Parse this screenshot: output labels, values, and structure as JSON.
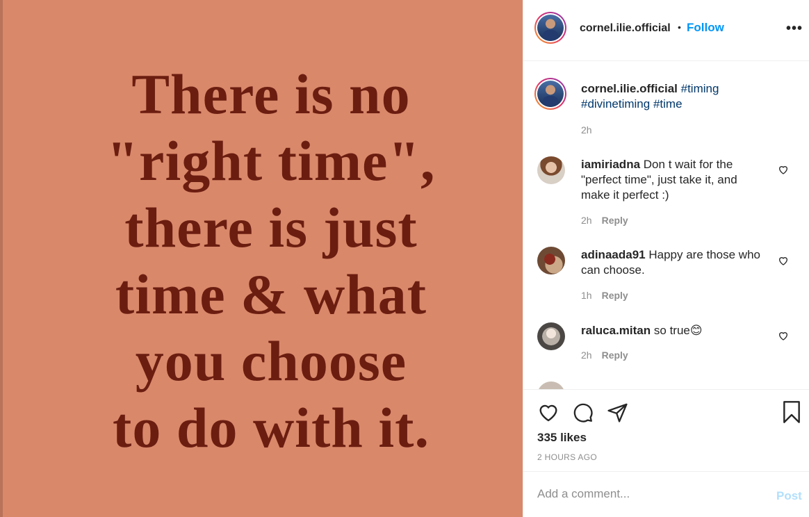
{
  "post_image": {
    "quote_lines": [
      "There is no",
      "\"right time\",",
      "there is just",
      "time & what",
      "you choose",
      "to do with it."
    ]
  },
  "header": {
    "username": "cornel.ilie.official",
    "separator": "•",
    "follow_label": "Follow",
    "more_label": "•••"
  },
  "caption": {
    "username": "cornel.ilie.official",
    "hashtag_1": "#timing",
    "hashtag_2": "#divinetiming",
    "hashtag_3": "#time",
    "time": "2h"
  },
  "comments": [
    {
      "username": "iamiriadna",
      "text": "Don t wait for the \"perfect time\", just take it, and make it perfect :)",
      "time": "2h",
      "reply_label": "Reply"
    },
    {
      "username": "adinaada91",
      "text": "Happy are those who can choose.",
      "time": "1h",
      "reply_label": "Reply"
    },
    {
      "username": "raluca.mitan",
      "text": "so true😊",
      "time": "2h",
      "reply_label": "Reply"
    }
  ],
  "actions": {
    "likes": "335 likes",
    "timestamp": "2 HOURS AGO"
  },
  "add_comment": {
    "placeholder": "Add a comment...",
    "post_label": "Post"
  },
  "colors": {
    "image_background": "#d9886a",
    "quote_text": "#6b1d10",
    "follow_blue": "#0095f6",
    "hashtag": "#00376b",
    "post_disabled": "#b2dffc"
  }
}
